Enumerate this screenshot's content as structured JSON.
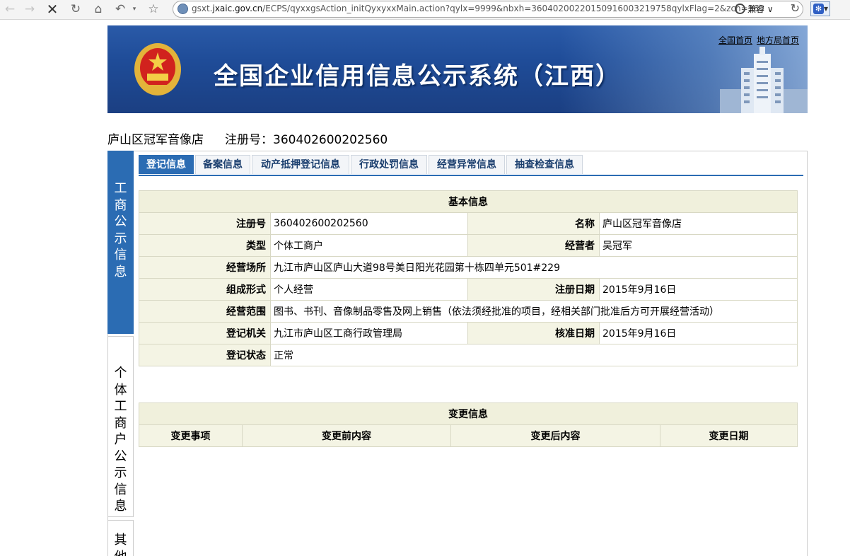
{
  "browser": {
    "url_prefix": "gsxt.",
    "url_domain": "jxaic.gov.cn",
    "url_path": "/ECPS/qyxxgsAction_initQyxyxxMain.action?qylx=9999&nbxh=36040200220150916003219758qylxFlag=2&zch=360",
    "compat_label": "兼容",
    "icons": [
      "back-icon",
      "forward-icon",
      "stop-icon",
      "refresh-icon",
      "home-icon",
      "history-back-icon",
      "favorite-star-icon"
    ]
  },
  "banner": {
    "title": "全国企业信用信息公示系统（江西）",
    "link_national": "全国首页",
    "link_local": "地方局首页"
  },
  "company": {
    "name": "庐山区冠军音像店",
    "reg_label": "注册号：360402600202560"
  },
  "sidebar": {
    "items": [
      {
        "label": [
          "工",
          "商",
          "公",
          "示",
          "信",
          "息"
        ]
      },
      {
        "label": [
          "个",
          "体",
          "工",
          "商",
          "户",
          "公",
          "示",
          "信",
          "息"
        ]
      },
      {
        "label": [
          "其",
          "他"
        ]
      }
    ]
  },
  "tabs": [
    "登记信息",
    "备案信息",
    "动产抵押登记信息",
    "行政处罚信息",
    "经营异常信息",
    "抽查检查信息"
  ],
  "basic_info": {
    "title": "基本信息",
    "reg_no_label": "注册号",
    "reg_no": "360402600202560",
    "name_label": "名称",
    "name": "庐山区冠军音像店",
    "type_label": "类型",
    "type": "个体工商户",
    "operator_label": "经营者",
    "operator": "吴冠军",
    "address_label": "经营场所",
    "address": "九江市庐山区庐山大道98号美日阳光花园第十栋四单元501#229",
    "form_label": "组成形式",
    "form": "个人经营",
    "reg_date_label": "注册日期",
    "reg_date": "2015年9月16日",
    "scope_label": "经营范围",
    "scope": "图书、书刊、音像制品零售及网上销售（依法须经批准的项目，经相关部门批准后方可开展经营活动）",
    "authority_label": "登记机关",
    "authority": "九江市庐山区工商行政管理局",
    "approve_date_label": "核准日期",
    "approve_date": "2015年9月16日",
    "status_label": "登记状态",
    "status": "正常"
  },
  "change_info": {
    "title": "变更信息",
    "columns": [
      "变更事项",
      "变更前内容",
      "变更后内容",
      "变更日期"
    ]
  }
}
